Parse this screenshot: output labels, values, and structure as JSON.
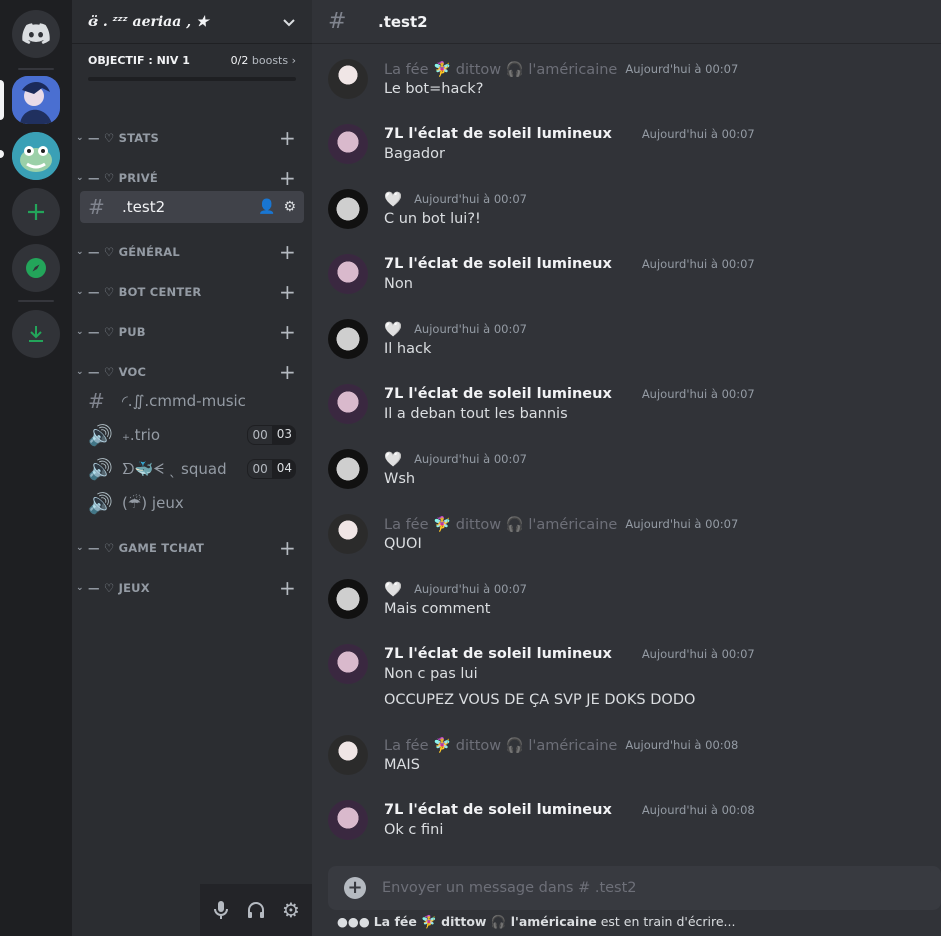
{
  "server": {
    "name": "ɞ̈ . ᶻᶻᶻ 𝒂𝒆𝒓𝒊𝒂𝒂 , ★",
    "boost_goal": "OBJECTIF : NIV 1",
    "boost_count": "0/2",
    "boost_unit": "boosts",
    "boost_progress": 0
  },
  "categories": [
    {
      "label": "— ♡ STATS"
    },
    {
      "label": "— ♡ PRIVÉ"
    },
    {
      "label": "— ♡ GÉNÉRAL"
    },
    {
      "label": "— ♡ BOT CENTER"
    },
    {
      "label": "— ♡ PUB"
    },
    {
      "label": "— ♡ VOC"
    },
    {
      "label": "— ♡ GAME TCHAT"
    },
    {
      "label": "— ♡ JEUX"
    }
  ],
  "channels": {
    "active": ".test2",
    "music": "◜.∬.cmmd-music",
    "trio": "₊.trio",
    "trio_a": "00",
    "trio_b": "03",
    "squad": "ᗤ🐳ᗕ ˎ  squad",
    "squad_a": "00",
    "squad_b": "04",
    "jeux": "(☔)  jeux"
  },
  "topbar": {
    "channel": ".test2"
  },
  "messages": [
    {
      "user": "La fée 🧚‍♀️ dittow 🎧 l'américaine",
      "time": "Aujourd'hui à 00:07",
      "text": "Le bot=hack?"
    },
    {
      "user": "7L l'éclat de soleil lumineux",
      "time": "Aujourd'hui à 00:07",
      "text": "Bagador"
    },
    {
      "user": "🤍",
      "time": "Aujourd'hui à 00:07",
      "text": "C un bot lui?!"
    },
    {
      "user": "7L l'éclat de soleil lumineux",
      "time": "Aujourd'hui à 00:07",
      "text": "Non"
    },
    {
      "user": "🤍",
      "time": "Aujourd'hui à 00:07",
      "text": "Il hack"
    },
    {
      "user": "7L l'éclat de soleil lumineux",
      "time": "Aujourd'hui à 00:07",
      "text": "Il a deban tout les bannis"
    },
    {
      "user": "🤍",
      "time": "Aujourd'hui à 00:07",
      "text": "Wsh"
    },
    {
      "user": "La fée 🧚‍♀️ dittow 🎧 l'américaine",
      "time": "Aujourd'hui à 00:07",
      "text": "QUOI"
    },
    {
      "user": "🤍",
      "time": "Aujourd'hui à 00:07",
      "text": "Mais comment"
    },
    {
      "user": "7L l'éclat de soleil lumineux",
      "time": "Aujourd'hui à 00:07",
      "text": "Non c pas lui",
      "text2": "OCCUPEZ VOUS DE ÇA SVP JE DOKS DODO"
    },
    {
      "user": "La fée 🧚‍♀️ dittow 🎧 l'américaine",
      "time": "Aujourd'hui à 00:08",
      "text": "MAIS"
    },
    {
      "user": "7L l'éclat de soleil lumineux",
      "time": "Aujourd'hui à 00:08",
      "text": "Ok c fini"
    }
  ],
  "composer": {
    "placeholder": "Envoyer un message dans #  .test2"
  },
  "typing": {
    "user": "La fée 🧚‍♀️ dittow 🎧 l'américaine",
    "suffix": "est en train d'écrire..."
  }
}
